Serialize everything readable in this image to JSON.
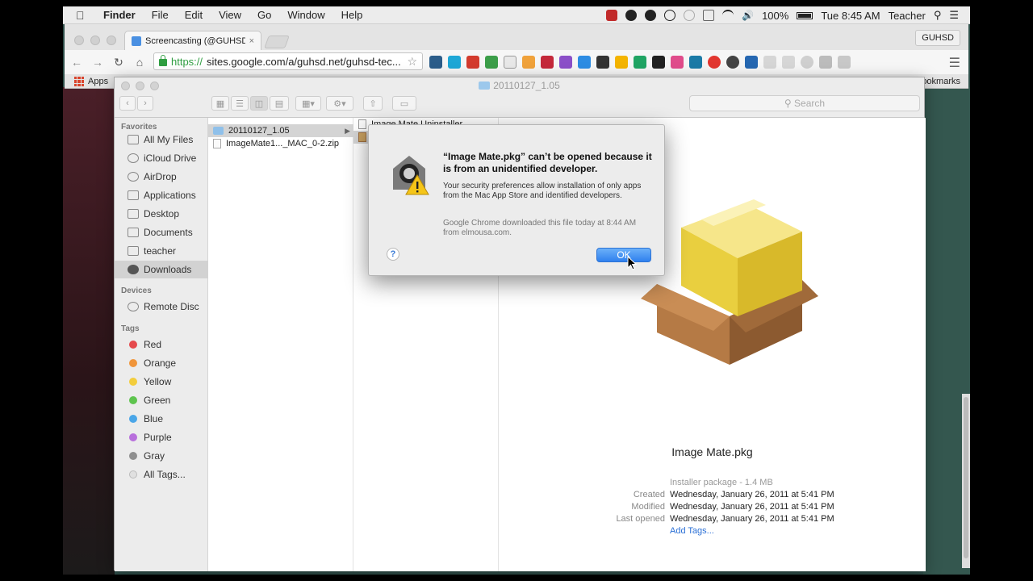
{
  "menubar": {
    "app": "Finder",
    "menus": [
      "File",
      "Edit",
      "View",
      "Go",
      "Window",
      "Help"
    ],
    "battery_pct": "100%",
    "clock": "Tue 8:45 AM",
    "user": "Teacher"
  },
  "browser": {
    "tab_title": "Screencasting (@GUHSDte",
    "tab_close": "×",
    "profile": "GUHSD",
    "url_scheme": "https://",
    "url_rest": "sites.google.com/a/guhsd.net/guhsd-tec...",
    "bookmarks_apps": "Apps",
    "bookmarks_other": "ookmarks"
  },
  "finder": {
    "title": "20110127_1.05",
    "search_placeholder": "Search",
    "sidebar": {
      "favorites_header": "Favorites",
      "favorites": [
        "All My Files",
        "iCloud Drive",
        "AirDrop",
        "Applications",
        "Desktop",
        "Documents",
        "teacher",
        "Downloads"
      ],
      "selected": "Downloads",
      "devices_header": "Devices",
      "devices": [
        "Remote Disc"
      ],
      "tags_header": "Tags",
      "tags": [
        {
          "name": "Red",
          "color": "#e5494c"
        },
        {
          "name": "Orange",
          "color": "#f0953a"
        },
        {
          "name": "Yellow",
          "color": "#f3cd3c"
        },
        {
          "name": "Green",
          "color": "#5ec44e"
        },
        {
          "name": "Blue",
          "color": "#4aa6e8"
        },
        {
          "name": "Purple",
          "color": "#b86fdc"
        },
        {
          "name": "Gray",
          "color": "#8f8f8f"
        }
      ],
      "all_tags": "All Tags..."
    },
    "column1": [
      {
        "name": "20110127_1.05",
        "kind": "folder"
      },
      {
        "name": "ImageMate1..._MAC_0-2.zip",
        "kind": "zip"
      }
    ],
    "column2": [
      {
        "name": "Image Mate Uninstaller",
        "kind": "app"
      }
    ],
    "preview": {
      "name": "Image Mate.pkg",
      "kind_size": "Installer package - 1.4 MB",
      "rows": [
        {
          "k": "Created",
          "v": "Wednesday, January 26, 2011 at 5:41 PM"
        },
        {
          "k": "Modified",
          "v": "Wednesday, January 26, 2011 at 5:41 PM"
        },
        {
          "k": "Last opened",
          "v": "Wednesday, January 26, 2011 at 5:41 PM"
        }
      ],
      "add_tags": "Add Tags..."
    }
  },
  "dialog": {
    "title": "“Image Mate.pkg” can’t be opened because it is from an unidentified developer.",
    "body": "Your security preferences allow installation of only apps from the Mac App Store and identified developers.",
    "source": "Google Chrome downloaded this file today at 8:44 AM from elmousa.com.",
    "help": "?",
    "ok": "OK"
  }
}
